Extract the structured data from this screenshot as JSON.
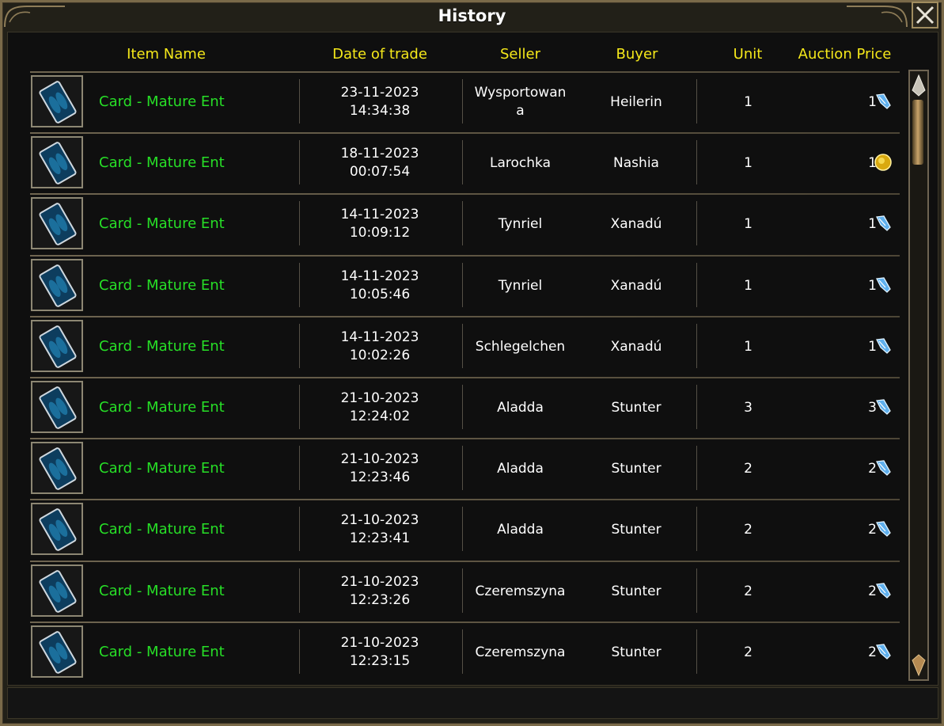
{
  "window": {
    "title": "History"
  },
  "columns": {
    "item_name": "Item Name",
    "date": "Date of trade",
    "seller": "Seller",
    "buyer": "Buyer",
    "unit": "Unit",
    "price": "Auction Price"
  },
  "rows": [
    {
      "item": "Card - Mature Ent",
      "date": "23-11-2023",
      "time": "14:34:38",
      "seller": "Wysportowan",
      "seller2": "a",
      "buyer": "Heilerin",
      "unit": "1",
      "price": "1",
      "currency": "crystal-icon"
    },
    {
      "item": "Card - Mature Ent",
      "date": "18-11-2023",
      "time": "00:07:54",
      "seller": "Larochka",
      "buyer": "Nashia",
      "unit": "1",
      "price": "1",
      "currency": "gold-coin-icon"
    },
    {
      "item": "Card - Mature Ent",
      "date": "14-11-2023",
      "time": "10:09:12",
      "seller": "Tynriel",
      "buyer": "Xanadú",
      "unit": "1",
      "price": "1",
      "currency": "crystal-icon"
    },
    {
      "item": "Card - Mature Ent",
      "date": "14-11-2023",
      "time": "10:05:46",
      "seller": "Tynriel",
      "buyer": "Xanadú",
      "unit": "1",
      "price": "1",
      "currency": "crystal-icon"
    },
    {
      "item": "Card - Mature Ent",
      "date": "14-11-2023",
      "time": "10:02:26",
      "seller": "Schlegelchen",
      "buyer": "Xanadú",
      "unit": "1",
      "price": "1",
      "currency": "crystal-icon"
    },
    {
      "item": "Card - Mature Ent",
      "date": "21-10-2023",
      "time": "12:24:02",
      "seller": "Aladda",
      "buyer": "Stunter",
      "unit": "3",
      "price": "3",
      "currency": "crystal-icon"
    },
    {
      "item": "Card - Mature Ent",
      "date": "21-10-2023",
      "time": "12:23:46",
      "seller": "Aladda",
      "buyer": "Stunter",
      "unit": "2",
      "price": "2",
      "currency": "crystal-icon"
    },
    {
      "item": "Card - Mature Ent",
      "date": "21-10-2023",
      "time": "12:23:41",
      "seller": "Aladda",
      "buyer": "Stunter",
      "unit": "2",
      "price": "2",
      "currency": "crystal-icon"
    },
    {
      "item": "Card - Mature Ent",
      "date": "21-10-2023",
      "time": "12:23:26",
      "seller": "Czeremszyna",
      "buyer": "Stunter",
      "unit": "2",
      "price": "2",
      "currency": "crystal-icon"
    },
    {
      "item": "Card - Mature Ent",
      "date": "21-10-2023",
      "time": "12:23:15",
      "seller": "Czeremszyna",
      "buyer": "Stunter",
      "unit": "2",
      "price": "2",
      "currency": "crystal-icon"
    }
  ],
  "icons": {
    "close": "close-x-icon",
    "card": "card-icon",
    "scroll_up": "scroll-up-arrow-icon",
    "scroll_down": "scroll-down-arrow-icon"
  },
  "colors": {
    "header_text": "#f5e81a",
    "item_text": "#27df27",
    "frame": "#7a6a49"
  }
}
